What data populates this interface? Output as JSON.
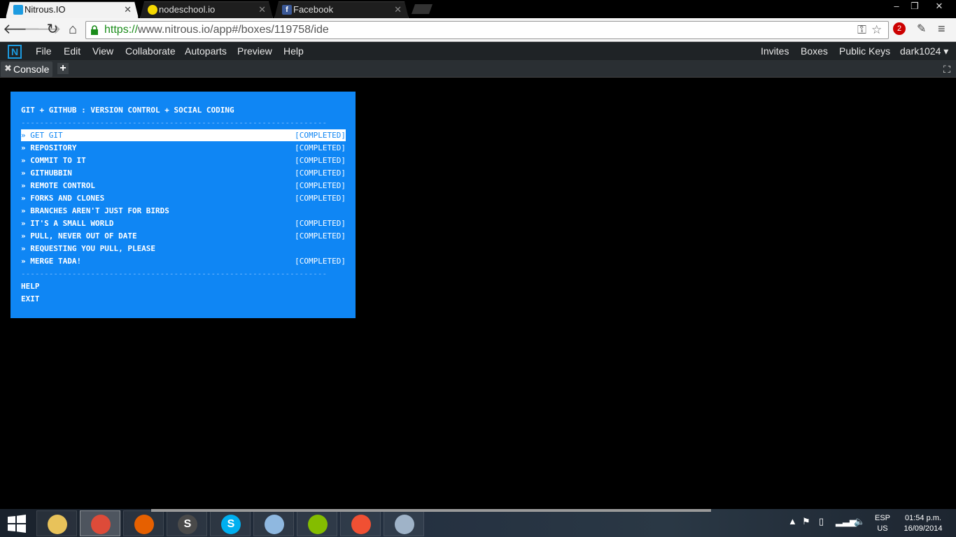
{
  "browser": {
    "tabs": [
      {
        "title": "Nitrous.IO",
        "active": true,
        "favicon_color": "#1c9be0"
      },
      {
        "title": "nodeschool.io",
        "active": false,
        "favicon_color": "#f5d800"
      },
      {
        "title": "Facebook",
        "active": false,
        "favicon_color": "#3b5998"
      }
    ],
    "window_controls": {
      "minimize": "–",
      "restore": "❐",
      "close": "✕"
    },
    "url_scheme": "https://",
    "url_rest": "www.nitrous.io/app#/boxes/119758/ide",
    "extension_badge": "2"
  },
  "app_menu": {
    "logo": "N",
    "left_items": [
      "File",
      "Edit",
      "View",
      "Collaborate",
      "Autoparts",
      "Preview",
      "Help"
    ],
    "right_items": [
      "Invites",
      "Boxes",
      "Public Keys"
    ],
    "user": "dark1024 ▾"
  },
  "panel_tabs": {
    "console_tab": "Console",
    "add_tab": "+"
  },
  "workshop": {
    "title": "GIT + GITHUB : VERSION CONTROL + SOCIAL CODING",
    "separator": "------------------------------------------------------------------",
    "lessons": [
      {
        "name": "» GET GIT",
        "status": "[COMPLETED]",
        "selected": true
      },
      {
        "name": "» REPOSITORY",
        "status": "[COMPLETED]",
        "selected": false
      },
      {
        "name": "» COMMIT TO IT",
        "status": "[COMPLETED]",
        "selected": false
      },
      {
        "name": "» GITHUBBIN",
        "status": "[COMPLETED]",
        "selected": false
      },
      {
        "name": "» REMOTE CONTROL",
        "status": "[COMPLETED]",
        "selected": false
      },
      {
        "name": "» FORKS AND CLONES",
        "status": "[COMPLETED]",
        "selected": false
      },
      {
        "name": "» BRANCHES AREN'T JUST FOR BIRDS",
        "status": "",
        "selected": false
      },
      {
        "name": "» IT'S A SMALL WORLD",
        "status": "[COMPLETED]",
        "selected": false
      },
      {
        "name": "» PULL, NEVER OUT OF DATE",
        "status": "[COMPLETED]",
        "selected": false
      },
      {
        "name": "» REQUESTING YOU PULL, PLEASE",
        "status": "",
        "selected": false
      },
      {
        "name": "» MERGE TADA!",
        "status": "[COMPLETED]",
        "selected": false
      }
    ],
    "help": "HELP",
    "exit": "EXIT"
  },
  "taskbar": {
    "apps": [
      {
        "name": "file-explorer",
        "glyph": "",
        "color": "#e8c25a"
      },
      {
        "name": "chrome",
        "glyph": "",
        "color": "#dd4b39",
        "active": true
      },
      {
        "name": "firefox",
        "glyph": "",
        "color": "#e66000"
      },
      {
        "name": "sublime-text",
        "glyph": "S",
        "color": "#4a4a4a"
      },
      {
        "name": "skype",
        "glyph": "S",
        "color": "#00aff0"
      },
      {
        "name": "virtualbox",
        "glyph": "",
        "color": "#8fb8e0"
      },
      {
        "name": "spotify",
        "glyph": "",
        "color": "#84bd00"
      },
      {
        "name": "git",
        "glyph": "",
        "color": "#f05033"
      },
      {
        "name": "resource-monitor",
        "glyph": "",
        "color": "#9fb3c8"
      }
    ],
    "lang_top": "ESP",
    "lang_bottom": "US",
    "time": "01:54 p.m.",
    "date": "16/09/2014"
  }
}
